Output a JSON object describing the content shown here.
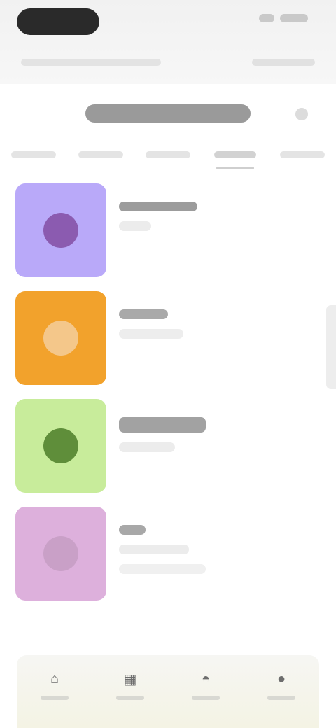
{
  "status_bar": {},
  "header": {
    "action_icon": "plus-icon"
  },
  "tabs": [
    {
      "active": false
    },
    {
      "active": false
    },
    {
      "active": false
    },
    {
      "active": true
    },
    {
      "active": false
    }
  ],
  "items": [
    {
      "tile_color": "#b9a9f9",
      "glyph_color": "#8b5bb0",
      "icon": "circle-icon"
    },
    {
      "tile_color": "#f2a22c",
      "glyph_color": "#f4c78a",
      "icon": "clock-icon"
    },
    {
      "tile_color": "#c8ec9b",
      "glyph_color": "#5f8e3a",
      "icon": "circle-icon"
    },
    {
      "tile_color": "#ddb0dc",
      "glyph_color": "#c9a0c7",
      "icon": "circle-icon"
    }
  ],
  "bottom_nav": {
    "icons": [
      "home-icon",
      "grid-icon",
      "bell-icon",
      "person-icon"
    ]
  }
}
